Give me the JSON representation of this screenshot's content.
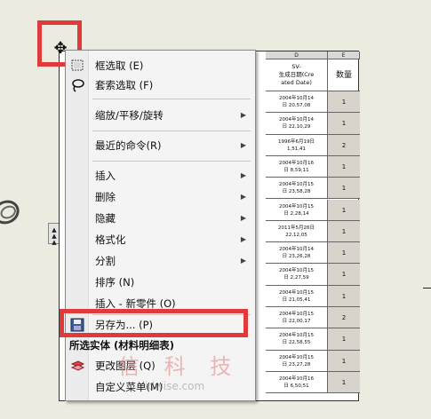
{
  "spreadsheet": {
    "columns": [
      "D",
      "E"
    ],
    "header_d": "SV-\n生成日期(Cre\nated Date)",
    "header_e": "数量",
    "rows": [
      {
        "date": "2004年10月14\n日 20,57,08",
        "qty": "1"
      },
      {
        "date": "2004年10月14\n日 22,10,29",
        "qty": "1"
      },
      {
        "date": "1996年6月19日\n1,51,41",
        "qty": "2"
      },
      {
        "date": "2004年10月16\n日 8,59,11",
        "qty": "1"
      },
      {
        "date": "2004年10月15\n日 23,58,28",
        "qty": "1"
      },
      {
        "date": "2004年10月15\n日 2,28,14",
        "qty": "1"
      },
      {
        "date": "2011年5月26日\n22,12,05",
        "qty": "1"
      },
      {
        "date": "2004年10月14\n日 23,26,28",
        "qty": "1"
      },
      {
        "date": "2004年10月15\n日 2,27,59",
        "qty": "1"
      },
      {
        "date": "2004年10月15\n日 21,05,41",
        "qty": "1"
      },
      {
        "date": "2004年10月15\n日 22,00,17",
        "qty": "2"
      },
      {
        "date": "2004年10月15\n日 22,58,55",
        "qty": "1"
      },
      {
        "date": "2004年10月15\n日 23,27,28",
        "qty": "1"
      },
      {
        "date": "2004年10月16\n日 6,50,51",
        "qty": "1"
      }
    ]
  },
  "context_menu": {
    "items": [
      {
        "label": "框选取 (E)",
        "icon": "box-select-icon"
      },
      {
        "label": "套索选取 (F)",
        "icon": "lasso-select-icon"
      },
      {
        "label": "缩放/平移/旋转",
        "submenu": true
      },
      {
        "label": "最近的命令(R)",
        "submenu": true
      },
      {
        "label": "插入",
        "submenu": true
      },
      {
        "label": "删除",
        "submenu": true
      },
      {
        "label": "隐藏",
        "submenu": true
      },
      {
        "label": "格式化",
        "submenu": true
      },
      {
        "label": "分割",
        "submenu": true
      },
      {
        "label": "排序 (N)"
      },
      {
        "label": "插入 - 新零件 (O)"
      },
      {
        "label": "另存为... (P)",
        "icon": "save-as-icon"
      },
      {
        "label": "更改图层 (Q)",
        "icon": "change-layer-icon"
      },
      {
        "label": "自定义菜单(M)"
      }
    ],
    "section_title": "所选实体 (材料明细表)"
  },
  "watermark": {
    "text": "信 科 技",
    "url": "idwise.com"
  },
  "colors": {
    "highlight": "#e03a3a",
    "background": "#ecebdf"
  },
  "icons": {
    "move_handle": "move-handle-icon"
  }
}
